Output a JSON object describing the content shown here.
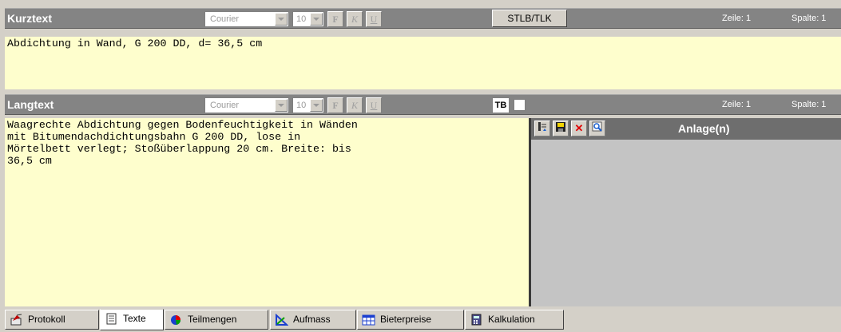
{
  "kurztext": {
    "title": "Kurztext",
    "font": "Courier",
    "size": "10",
    "bold_label": "F",
    "italic_label": "K",
    "underline_label": "U",
    "stlb_button": "STLB/TLK",
    "zeile": "Zeile: 1",
    "spalte": "Spalte: 1",
    "text": "Abdichtung in Wand, G 200 DD, d= 36,5 cm"
  },
  "langtext": {
    "title": "Langtext",
    "font": "Courier",
    "size": "10",
    "bold_label": "F",
    "italic_label": "K",
    "underline_label": "U",
    "tb_button": "TB",
    "zeile": "Zeile: 1",
    "spalte": "Spalte: 1",
    "text": "Waagrechte Abdichtung gegen Bodenfeuchtigkeit in Wänden\nmit Bitumendachdichtungsbahn G 200 DD, lose in\nMörtelbett verlegt; Stoßüberlappung 20 cm. Breite: bis\n36,5 cm"
  },
  "anlagen": {
    "title": "Anlage(n)",
    "tools": [
      "import-icon",
      "save-icon",
      "delete-icon",
      "view-icon"
    ]
  },
  "tabs": [
    {
      "label": "Protokoll",
      "icon": "protocol-icon"
    },
    {
      "label": "Texte",
      "icon": "document-icon"
    },
    {
      "label": "Teilmengen",
      "icon": "pie-icon"
    },
    {
      "label": "Aufmass",
      "icon": "measure-icon"
    },
    {
      "label": "Bieterpreise",
      "icon": "table-icon"
    },
    {
      "label": "Kalkulation",
      "icon": "calculator-icon"
    }
  ],
  "colors": {
    "editor_bg": "#fefecd",
    "bar_bg": "#848484",
    "panel_bg": "#c4c4c4"
  }
}
